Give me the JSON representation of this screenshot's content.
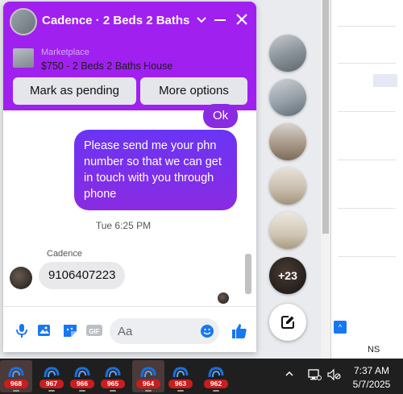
{
  "chat": {
    "title": "Cadence · 2 Beds 2 Baths",
    "marketplace_label": "Marketplace",
    "listing": "$750 - 2 Beds 2 Baths House",
    "actions": {
      "pending": "Mark as pending",
      "more": "More options"
    },
    "messages": {
      "ok": "Ok",
      "sent": "Please send me your phn number so that we can get in touch with you through phone",
      "timestamp": "Tue 6:25 PM",
      "sender_name": "Cadence",
      "received": "9106407223"
    },
    "composer": {
      "placeholder": "Aa",
      "gif": "GIF"
    }
  },
  "chat_heads": {
    "more_count": "+23"
  },
  "background": {
    "partial_text": "NS"
  },
  "taskbar": {
    "items": [
      {
        "badge": "968",
        "active": true
      },
      {
        "badge": "967",
        "active": false
      },
      {
        "badge": "966",
        "active": false
      },
      {
        "badge": "965",
        "active": false
      },
      {
        "badge": "964",
        "active": true
      },
      {
        "badge": "963",
        "active": false
      },
      {
        "badge": "962",
        "active": false
      }
    ],
    "clock_time": "7:37 AM",
    "clock_date": "5/7/2025"
  },
  "colors": {
    "header": "#a020f0",
    "sent_bubble": "#8a2be2",
    "accent_blue": "#1877f2",
    "badge_red": "#c81e1e"
  }
}
